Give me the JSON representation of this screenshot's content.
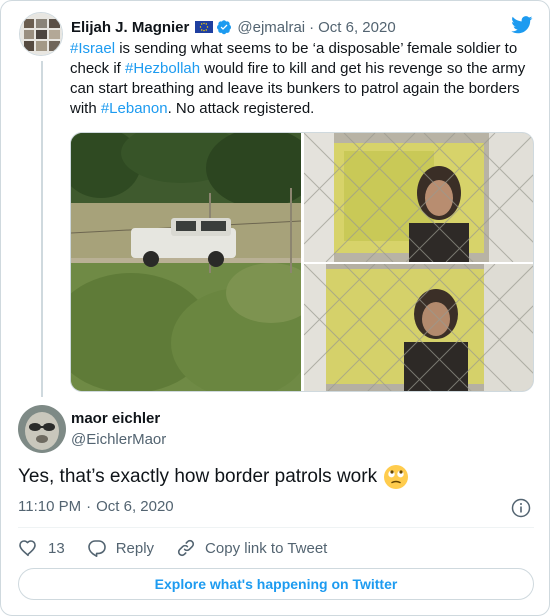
{
  "colors": {
    "link": "#1d9bf0",
    "text": "#0f1419",
    "secondary": "#536471",
    "border": "#cfd9de"
  },
  "quoted_tweet": {
    "author_name": "Elijah J. Magnier",
    "author_handle": "@ejmalrai",
    "date": "Oct 6, 2020",
    "badges": [
      "eu-flag-icon",
      "verified-icon"
    ],
    "text_segments": [
      {
        "text": "#Israel",
        "hashtag": true
      },
      {
        "text": " is sending what seems to be ‘a disposable’ female soldier to check if ",
        "hashtag": false
      },
      {
        "text": "#Hezbollah",
        "hashtag": true
      },
      {
        "text": " would fire to kill and get his revenge so the army can start breathing and leave its bunkers to patrol again the borders with ",
        "hashtag": false
      },
      {
        "text": "#Lebanon",
        "hashtag": true
      },
      {
        "text": ". No attack registered.",
        "hashtag": false
      }
    ],
    "media_count": 3
  },
  "reply_tweet": {
    "author_name": "maor eichler",
    "author_handle": "@EichlerMaor",
    "text": "Yes, that’s exactly how border patrols work",
    "emoji": "face-with-rolling-eyes",
    "time": "11:10 PM",
    "date": "Oct 6, 2020"
  },
  "actions": {
    "like_count": "13",
    "reply_label": "Reply",
    "copy_link_label": "Copy link to Tweet"
  },
  "explore_label": "Explore what's happening on Twitter",
  "icons": [
    "twitter-bird-icon",
    "info-icon",
    "heart-icon",
    "reply-bubble-icon",
    "link-icon"
  ]
}
